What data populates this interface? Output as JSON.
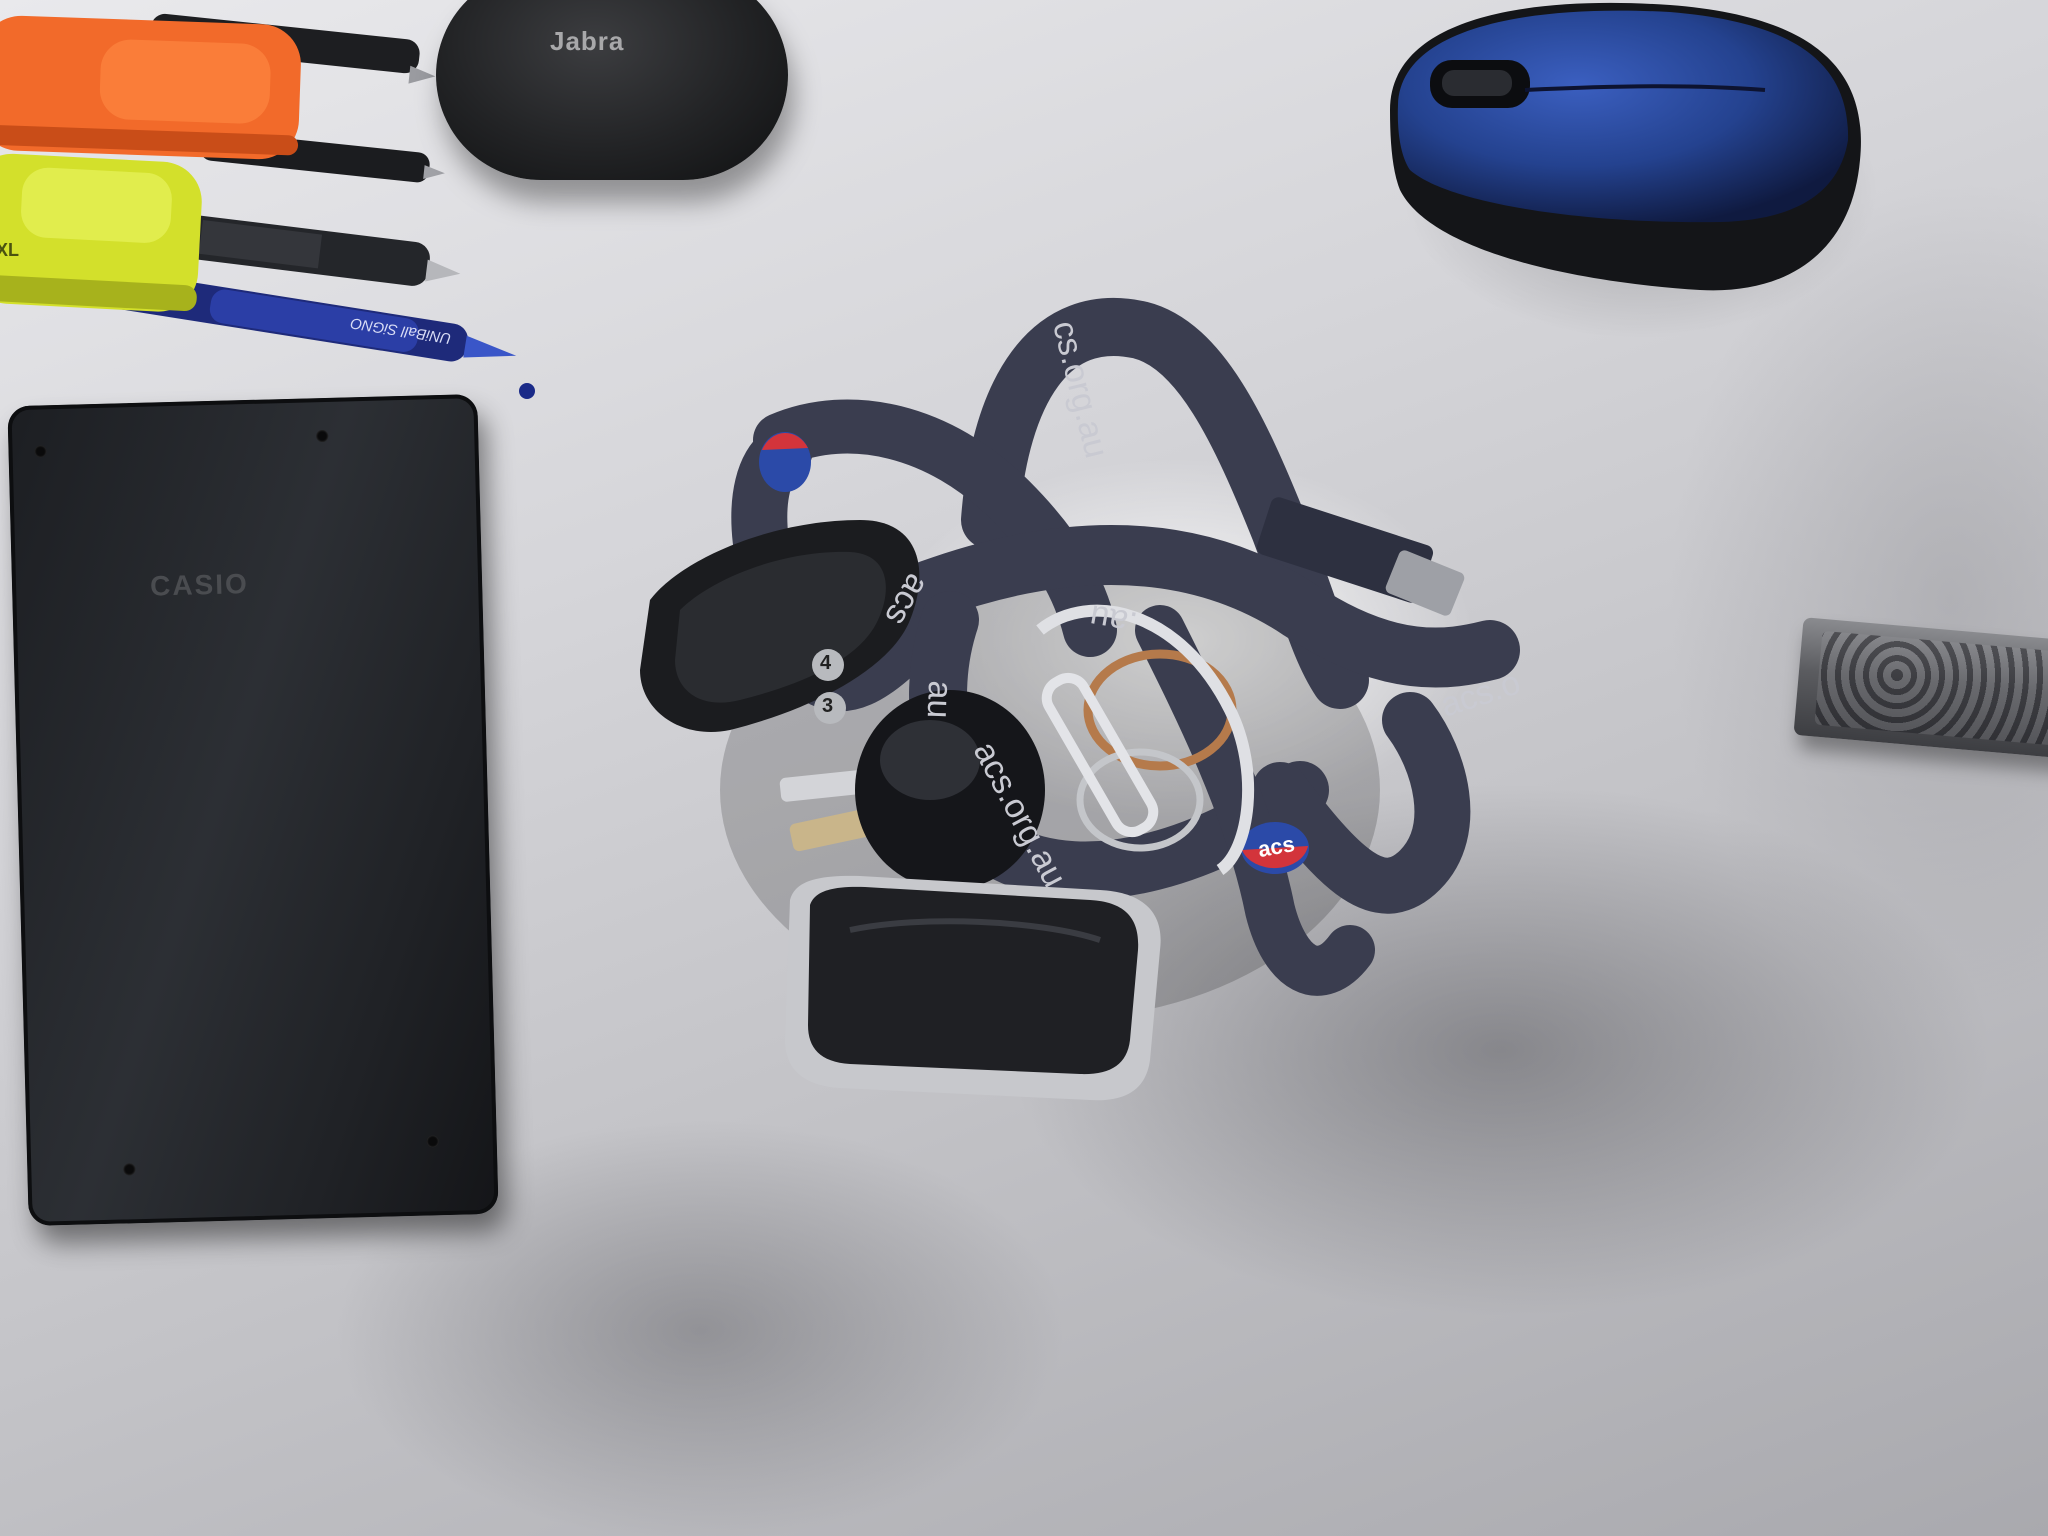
{
  "scene": {
    "calculator": {
      "brand": "CASIO"
    },
    "earbuds_case": {
      "brand": "Jabra"
    },
    "pens": {
      "highlighter_label": "XL",
      "pen_label": "UNiBall SiGNO"
    },
    "lanyard": {
      "prints": [
        "cs.org.au",
        "acs.o",
        "acs.org.au",
        ".au",
        "au",
        "acs"
      ],
      "logo_text": "acs"
    },
    "key_fob": {
      "buttons": [
        "4",
        "3"
      ]
    }
  },
  "colors": {
    "desk_light": "#e6e6ea",
    "calculator_body": "#25282c",
    "mouse_blue": "#24428f",
    "mouse_black": "#141518",
    "highlighter_orange": "#f26a2a",
    "highlighter_yellow": "#d3e02b",
    "lanyard_navy": "#3a3d4f",
    "acs_logo_red": "#d3343b",
    "acs_logo_blue": "#2b4aa8"
  },
  "icons": [
    "calculator",
    "earbuds-case",
    "computer-mouse",
    "car-key-fob",
    "lanyard",
    "pen",
    "highlighter",
    "key-ring",
    "carabiner"
  ]
}
